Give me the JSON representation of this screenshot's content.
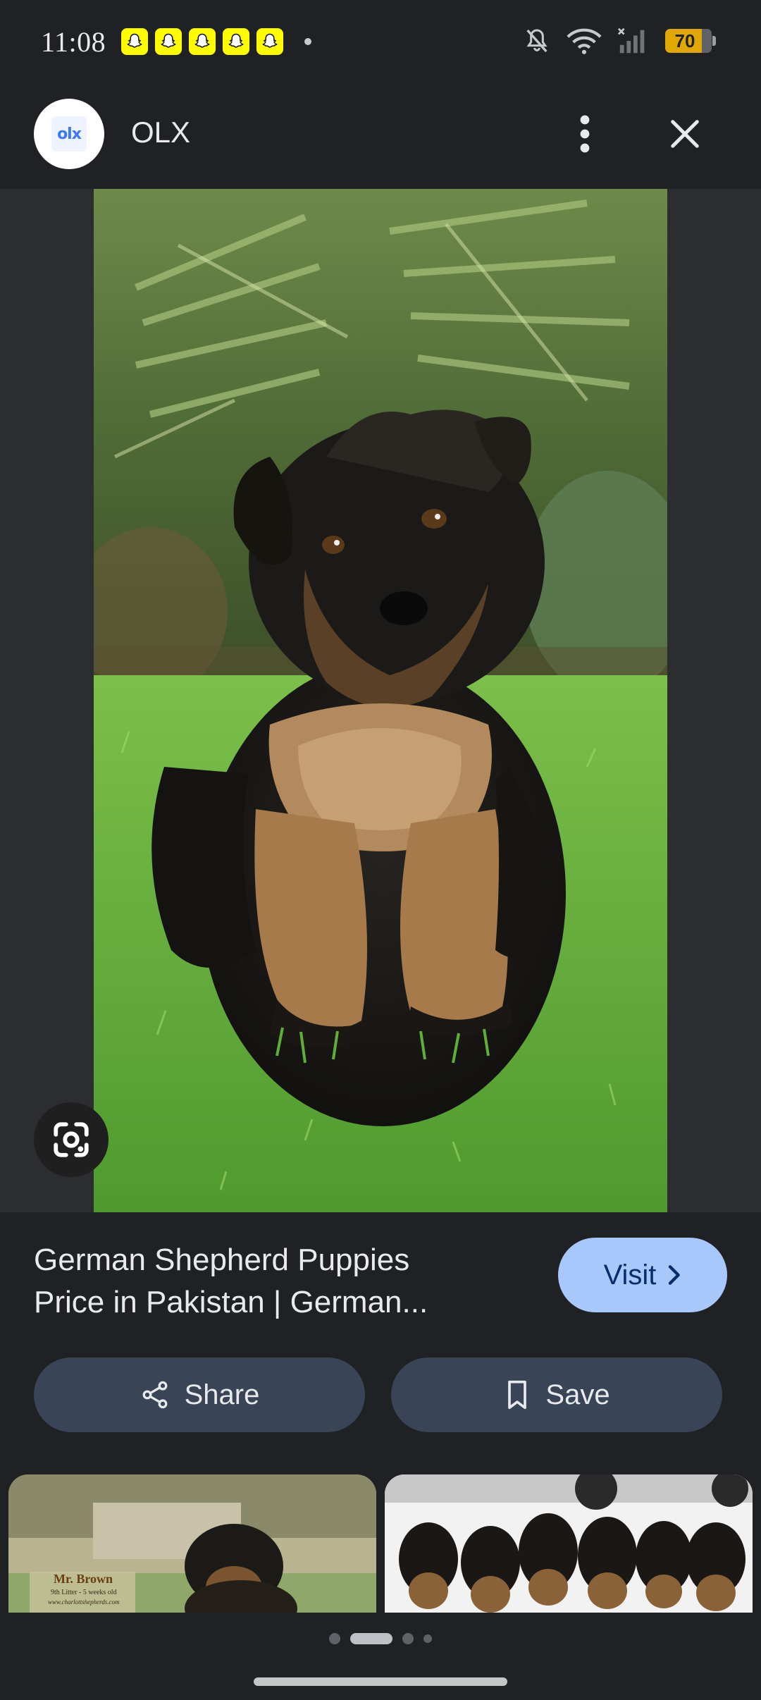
{
  "status_bar": {
    "time": "11:08",
    "battery_level": "70",
    "notification_icons": [
      "snapchat-icon",
      "snapchat-icon",
      "snapchat-icon",
      "snapchat-icon",
      "snapchat-icon"
    ],
    "system_icons": [
      "mute-icon",
      "wifi-icon",
      "signal-icon",
      "battery-icon"
    ]
  },
  "header": {
    "site_name": "OLX",
    "logo_text": "olx",
    "icons": [
      "more-vert-icon",
      "close-icon"
    ]
  },
  "result": {
    "title_line1": "German Shepherd Puppies",
    "title_line2": "Price in Pakistan | German...",
    "visit_label": "Visit",
    "share_label": "Share",
    "save_label": "Save"
  },
  "related": {
    "thumb1_caption": "Mr. Brown",
    "thumb1_subcaption": "9th Litter - 5 weeks old",
    "thumb1_url": "www.charlottshepherds.com"
  },
  "colors": {
    "background": "#202124",
    "visit_button": "#a8c7fa",
    "action_button": "#394457",
    "snapchat_yellow": "#fffc00",
    "battery": "#e0a800"
  },
  "pager": {
    "pages": 4,
    "active_index": 1
  }
}
